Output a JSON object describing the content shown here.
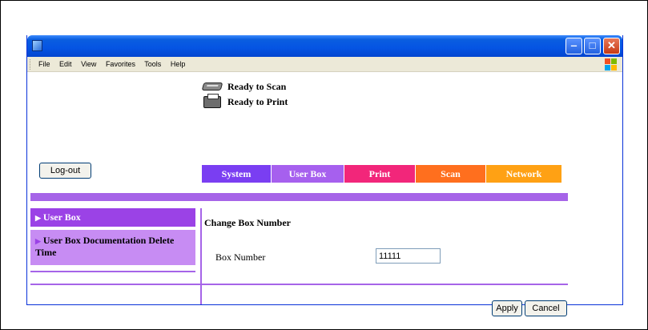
{
  "window": {
    "menu": [
      "File",
      "Edit",
      "View",
      "Favorites",
      "Tools",
      "Help"
    ],
    "minimize_glyph": "‒",
    "maximize_glyph": "□",
    "close_glyph": "✕"
  },
  "status": {
    "scan": "Ready to Scan",
    "print": "Ready to Print"
  },
  "logout_label": "Log-out",
  "tabs": [
    {
      "label": "System",
      "color": "#7a3ef2"
    },
    {
      "label": "User Box",
      "color": "#a660ee"
    },
    {
      "label": "Print",
      "color": "#f2267a"
    },
    {
      "label": "Scan",
      "color": "#ff6f1e"
    },
    {
      "label": "Network",
      "color": "#ffa114"
    }
  ],
  "sidebar": {
    "items": [
      {
        "label": "User Box",
        "selected": true
      },
      {
        "label": "User Box Documentation Delete Time",
        "selected": false
      }
    ]
  },
  "main": {
    "title": "Change Box Number",
    "box_number_label": "Box Number",
    "box_number_value": "11111"
  },
  "buttons": {
    "apply": "Apply",
    "cancel": "Cancel"
  },
  "colors": {
    "accent_purple": "#a664e8",
    "sidebar_selected": "#9b42e6",
    "sidebar_item": "#c78cf3"
  }
}
